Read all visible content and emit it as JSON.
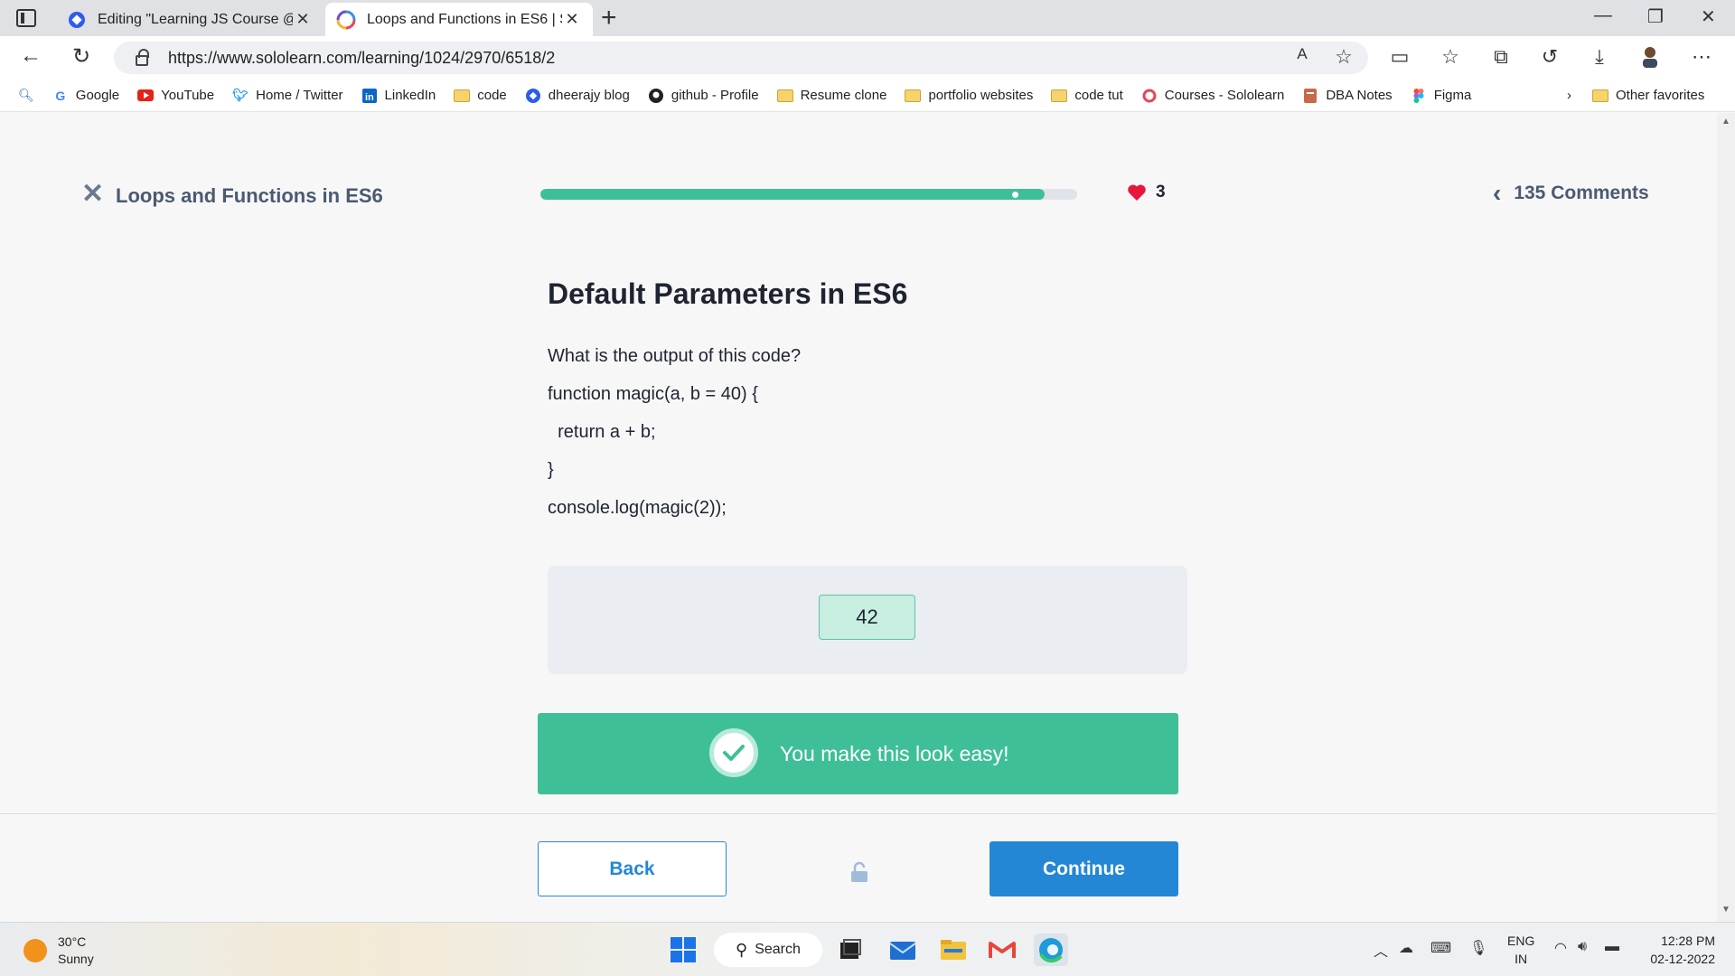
{
  "browser": {
    "tabs": [
      {
        "title": "Editing \"Learning JS Course @Sc",
        "active": false
      },
      {
        "title": "Loops and Functions in ES6 | Sol",
        "active": true
      }
    ],
    "url": "https://www.sololearn.com/learning/1024/2970/6518/2",
    "bookmarks": [
      {
        "label": "Google",
        "icon": "google-icon"
      },
      {
        "label": "YouTube",
        "icon": "youtube-icon"
      },
      {
        "label": "Home / Twitter",
        "icon": "twitter-icon"
      },
      {
        "label": "LinkedIn",
        "icon": "linkedin-icon"
      },
      {
        "label": "code",
        "icon": "folder-icon"
      },
      {
        "label": "dheerajy blog",
        "icon": "blog-icon"
      },
      {
        "label": "github - Profile",
        "icon": "github-icon"
      },
      {
        "label": "Resume clone",
        "icon": "folder-icon"
      },
      {
        "label": "portfolio websites",
        "icon": "folder-icon"
      },
      {
        "label": "code tut",
        "icon": "folder-icon"
      },
      {
        "label": "Courses - Sololearn",
        "icon": "sololearn-icon"
      },
      {
        "label": "DBA Notes",
        "icon": "notes-icon"
      },
      {
        "label": "Figma",
        "icon": "figma-icon"
      }
    ],
    "other_favorites": "Other favorites"
  },
  "lesson": {
    "title": "Loops and Functions in ES6",
    "progress_fraction": 0.94,
    "lives": "3",
    "comments": "135 Comments"
  },
  "question": {
    "title": "Default Parameters in ES6",
    "prompt": "What is the output of this code?",
    "code_lines": [
      "function magic(a, b = 40) {",
      "  return a + b;",
      "}",
      "console.log(magic(2));"
    ],
    "answer": "42"
  },
  "feedback": {
    "message": "You make this look easy!"
  },
  "footer": {
    "back_label": "Back",
    "continue_label": "Continue"
  },
  "taskbar": {
    "temperature": "30°C",
    "condition": "Sunny",
    "search_label": "Search",
    "lang_1": "ENG",
    "lang_2": "IN",
    "time": "12:28 PM",
    "date": "02-12-2022"
  },
  "colors": {
    "accent_green": "#3fbf98",
    "accent_blue": "#2487d5",
    "heart_red": "#e5173f"
  }
}
